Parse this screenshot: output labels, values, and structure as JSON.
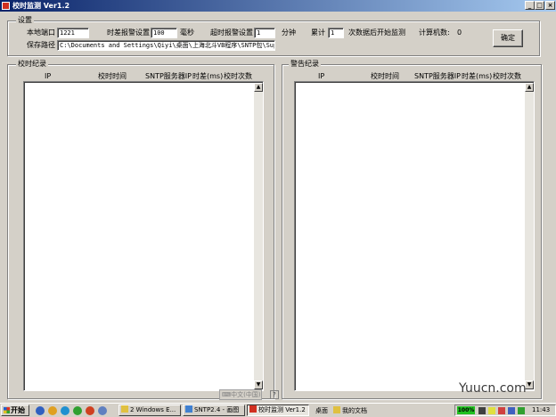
{
  "window": {
    "title": "校时监测 Ver1.2",
    "min_label": "_",
    "max_label": "□",
    "close_label": "×"
  },
  "settings": {
    "group_title": "设置",
    "local_port_label": "本地端口",
    "local_port_value": "1221",
    "time_diff_label": "时差报警设置",
    "time_diff_value": "100",
    "time_diff_unit": "毫秒",
    "timeout_label": "超时报警设置",
    "timeout_value": "1",
    "timeout_unit": "分钟",
    "accum_label": "累计",
    "accum_value": "1",
    "accum_suffix": "次数据后开始监测",
    "count_label": "计算机数:",
    "count_value": "0",
    "save_path_label": "保存路径",
    "save_path_value": "C:\\Documents and Settings\\Qiyi\\桌面\\上海北斗VB程序\\SNTP包\\Support",
    "confirm_button": "确定"
  },
  "timing_log": {
    "title": "校时纪录",
    "columns": [
      "IP",
      "校时时间",
      "SNTP服务器IP",
      "时差(ms)",
      "校时次数"
    ]
  },
  "alarm_log": {
    "title": "警告纪录",
    "columns": [
      "IP",
      "校时时间",
      "SNTP服务器IP",
      "时差(ms)",
      "校时次数"
    ]
  },
  "scroll": {
    "up": "▲",
    "down": "▼"
  },
  "ime": {
    "label": "中文(中国)"
  },
  "taskbar": {
    "start_label": "开始",
    "tasks": [
      {
        "label": "2 Windows E...",
        "arrow": "▾"
      },
      {
        "label": "SNTP2.4 - 画图"
      },
      {
        "label": "校时监测 Ver1.2"
      },
      {
        "label": "桌面"
      },
      {
        "label": "我的文档"
      }
    ],
    "tray": {
      "battery": "100%",
      "clock": "11:43"
    }
  },
  "watermark": "Yuucn.com",
  "colors": {
    "title_start": "#0a246a",
    "title_end": "#a6caf0",
    "face": "#d4d0c8"
  }
}
